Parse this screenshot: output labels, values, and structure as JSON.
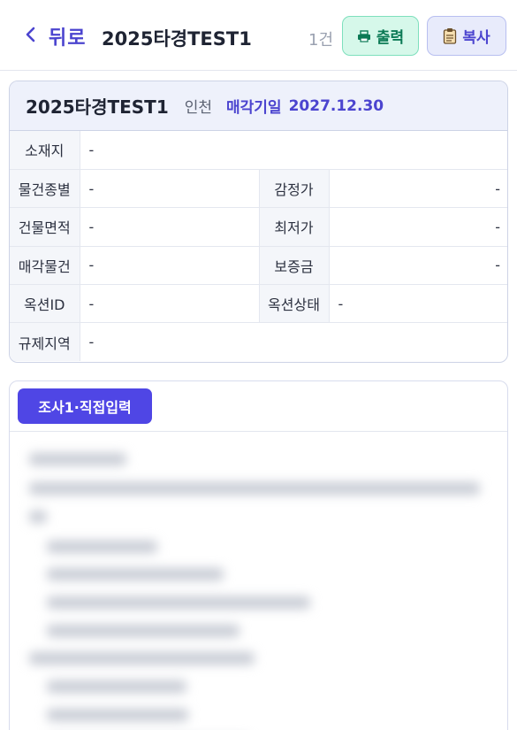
{
  "header": {
    "back_label": "뒤로",
    "title": "2025타경TEST1",
    "count": "1건",
    "print_label": "출력",
    "copy_label": "복사"
  },
  "summary": {
    "title": "2025타경TEST1",
    "region": "인천",
    "sale_label": "매각기일",
    "sale_date": "2027.12.30"
  },
  "details": {
    "location_label": "소재지",
    "location_value": "-",
    "type_label": "물건종별",
    "type_value": "-",
    "appraisal_label": "감정가",
    "appraisal_value": "-",
    "building_area_label": "건물면적",
    "building_area_value": "-",
    "min_price_label": "최저가",
    "min_price_value": "-",
    "sale_item_label": "매각물건",
    "sale_item_value": "-",
    "deposit_label": "보증금",
    "deposit_value": "-",
    "auction_id_label": "옥션ID",
    "auction_id_value": "-",
    "auction_status_label": "옥션상태",
    "auction_status_value": "-",
    "zoning_label": "규제지역",
    "zoning_value": "-"
  },
  "survey": {
    "tag_label": "조사1·직접입력"
  },
  "colors": {
    "accent": "#4f46e5",
    "print_bg": "#d6f8ea",
    "copy_bg": "#e8ebfb"
  }
}
